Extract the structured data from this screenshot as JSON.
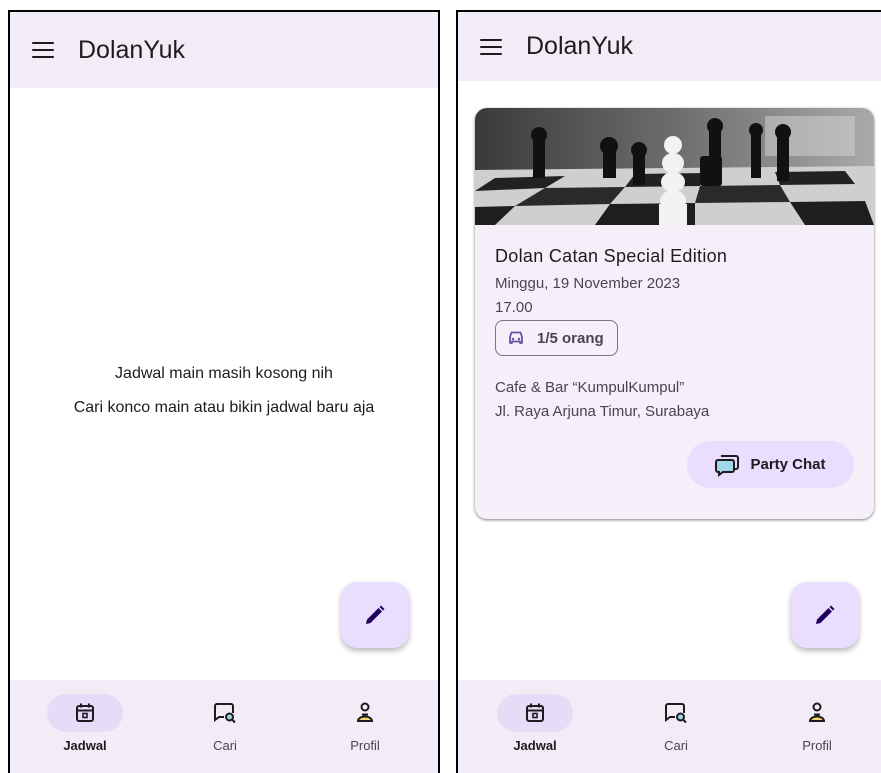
{
  "app": {
    "title": "DolanYuk"
  },
  "empty_state": {
    "line1": "Jadwal main masih kosong nih",
    "line2": "Cari konco main atau bikin jadwal baru aja"
  },
  "event_card": {
    "title": "Dolan Catan Special Edition",
    "date": "Minggu, 19 November 2023",
    "time": "17.00",
    "capacity": "1/5 orang",
    "venue": "Cafe & Bar “KumpulKumpul”",
    "address": "Jl. Raya Arjuna Timur, Surabaya",
    "chat_button": "Party Chat"
  },
  "nav": {
    "items": [
      {
        "label": "Jadwal",
        "icon": "calendar-icon",
        "active": true
      },
      {
        "label": "Cari",
        "icon": "search-chat-icon",
        "active": false
      },
      {
        "label": "Profil",
        "icon": "profile-icon",
        "active": false
      }
    ]
  },
  "icons": {
    "menu": "menu-icon",
    "fab": "pencil-icon",
    "capacity": "car-icon",
    "chat": "chat-icon"
  },
  "colors": {
    "surface": "#f2ecf7",
    "fab": "#e9defd",
    "accent": "#6750a4",
    "on_surface": "#1d1b20",
    "card": "#f4eff8"
  }
}
